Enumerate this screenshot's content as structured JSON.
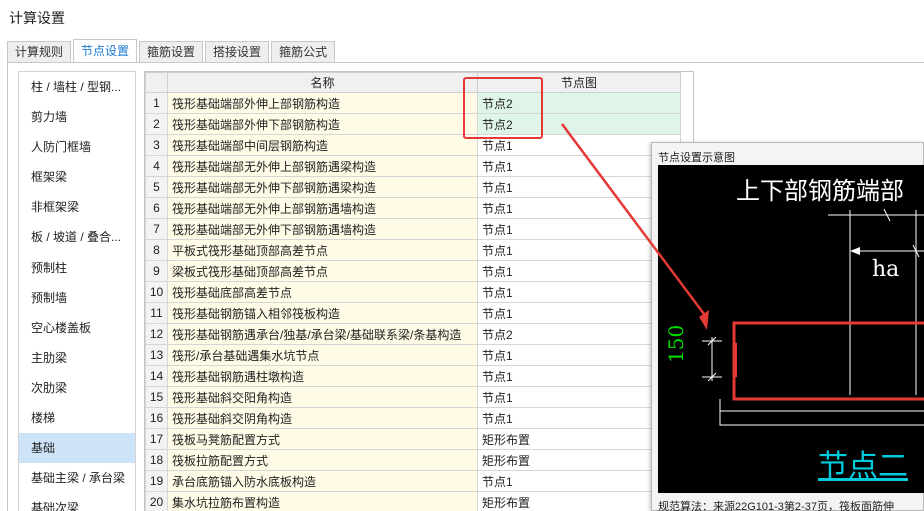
{
  "window": {
    "title": "计算设置"
  },
  "tabs": [
    {
      "label": "计算规则",
      "active": false
    },
    {
      "label": "节点设置",
      "active": true
    },
    {
      "label": "箍筋设置",
      "active": false
    },
    {
      "label": "搭接设置",
      "active": false
    },
    {
      "label": "箍筋公式",
      "active": false
    }
  ],
  "sidebar": {
    "items": [
      {
        "label": "柱 / 墙柱 / 型钢..."
      },
      {
        "label": "剪力墙"
      },
      {
        "label": "人防门框墙"
      },
      {
        "label": "框架梁"
      },
      {
        "label": "非框架梁"
      },
      {
        "label": "板 / 坡道 / 叠合..."
      },
      {
        "label": "预制柱"
      },
      {
        "label": "预制墙"
      },
      {
        "label": "空心楼盖板"
      },
      {
        "label": "主肋梁"
      },
      {
        "label": "次肋梁"
      },
      {
        "label": "楼梯"
      },
      {
        "label": "基础",
        "active": true
      },
      {
        "label": "基础主梁 / 承台梁"
      },
      {
        "label": "基础次梁"
      }
    ]
  },
  "table": {
    "columns": {
      "name": "名称",
      "node": "节点图"
    },
    "rows": [
      {
        "num": "1",
        "name": "筏形基础端部外伸上部钢筋构造",
        "node": "节点2",
        "changed": true
      },
      {
        "num": "2",
        "name": "筏形基础端部外伸下部钢筋构造",
        "node": "节点2",
        "changed": true
      },
      {
        "num": "3",
        "name": "筏形基础端部中间层钢筋构造",
        "node": "节点1"
      },
      {
        "num": "4",
        "name": "筏形基础端部无外伸上部钢筋遇梁构造",
        "node": "节点1"
      },
      {
        "num": "5",
        "name": "筏形基础端部无外伸下部钢筋遇梁构造",
        "node": "节点1"
      },
      {
        "num": "6",
        "name": "筏形基础端部无外伸上部钢筋遇墙构造",
        "node": "节点1"
      },
      {
        "num": "7",
        "name": "筏形基础端部无外伸下部钢筋遇墙构造",
        "node": "节点1"
      },
      {
        "num": "8",
        "name": "平板式筏形基础顶部高差节点",
        "node": "节点1"
      },
      {
        "num": "9",
        "name": "梁板式筏形基础顶部高差节点",
        "node": "节点1"
      },
      {
        "num": "10",
        "name": "筏形基础底部高差节点",
        "node": "节点1"
      },
      {
        "num": "11",
        "name": "筏形基础钢筋锚入相邻筏板构造",
        "node": "节点1"
      },
      {
        "num": "12",
        "name": "筏形基础钢筋遇承台/独基/承台梁/基础联系梁/条基构造",
        "node": "节点2"
      },
      {
        "num": "13",
        "name": "筏形/承台基础遇集水坑节点",
        "node": "节点1"
      },
      {
        "num": "14",
        "name": "筏形基础钢筋遇柱墩构造",
        "node": "节点1"
      },
      {
        "num": "15",
        "name": "筏形基础斜交阳角构造",
        "node": "节点1"
      },
      {
        "num": "16",
        "name": "筏形基础斜交阴角构造",
        "node": "节点1"
      },
      {
        "num": "17",
        "name": "筏板马凳筋配置方式",
        "node": "矩形布置"
      },
      {
        "num": "18",
        "name": "筏板拉筋配置方式",
        "node": "矩形布置"
      },
      {
        "num": "19",
        "name": "承台底筋锚入防水底板构造",
        "node": "节点1"
      },
      {
        "num": "20",
        "name": "集水坑拉筋布置构造",
        "node": "矩形布置"
      }
    ]
  },
  "popup": {
    "title": "节点设置示意图",
    "drawing_title": "上下部钢筋端部",
    "dim_ha": "ha",
    "dim_150": "150",
    "node_label": "节点二",
    "caption": "规范算法：来源22G101-3第2-37页，筏板面筋伸"
  },
  "colors": {
    "accent": "#1e7ad6",
    "highlight": "#e53935",
    "selected_side": "#cde3f7",
    "changed_cell": "#dff5e8",
    "name_cell": "#fffbe6"
  }
}
